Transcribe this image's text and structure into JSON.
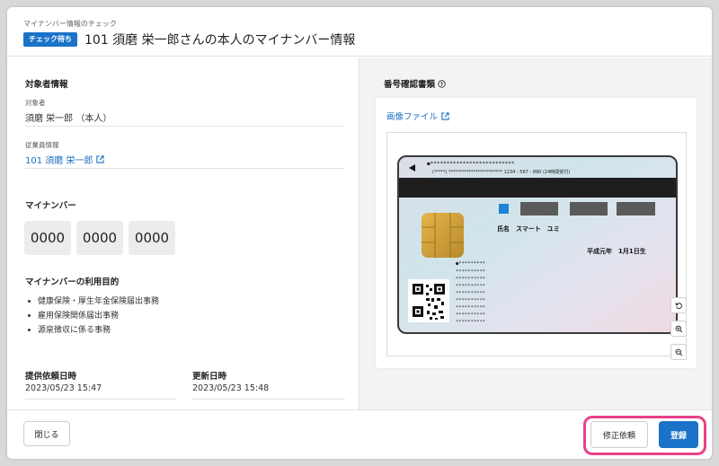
{
  "header": {
    "breadcrumb": "マイナンバー情報のチェック",
    "badge": "チェック待ち",
    "title": "101 須磨 栄一郎さんの本人のマイナンバー情報"
  },
  "target": {
    "section_title": "対象者情報",
    "person_label": "対象者",
    "person_value": "須磨 栄一郎 （本人）",
    "employee_label": "従業員情報",
    "employee_link": "101 須磨 栄一郎"
  },
  "mynumber": {
    "title": "マイナンバー",
    "groups": [
      "0000",
      "0000",
      "0000"
    ]
  },
  "purpose": {
    "title": "マイナンバーの利用目的",
    "items": [
      "健康保険・厚生年金保険届出事務",
      "雇用保険関係届出事務",
      "源泉徴収に係る事務"
    ]
  },
  "dates": {
    "requested_label": "提供依頼日時",
    "requested_value": "2023/05/23 15:47",
    "updated_label": "更新日時",
    "updated_value": "2023/05/23 15:48"
  },
  "document": {
    "title": "番号確認書類",
    "image_link": "画像ファイル",
    "card": {
      "line1": "●**************************",
      "line2": "(*****)  ************************   1234 - 567 - 890 (24時間受付)",
      "name": "氏名　スマート　ユミ",
      "birth": "平成元年　1月1日生",
      "dots": "●*********"
    }
  },
  "footer": {
    "close": "閉じる",
    "request_fix": "修正依頼",
    "register": "登録"
  },
  "colors": {
    "accent": "#1a73c8",
    "highlight": "#e8418a",
    "link": "#1a6fc4"
  }
}
